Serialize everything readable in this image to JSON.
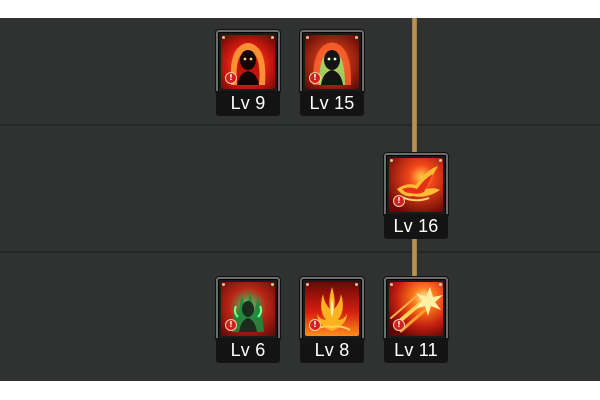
{
  "skill_tree": {
    "skills": [
      {
        "level": "Lv 9"
      },
      {
        "level": "Lv 15"
      },
      {
        "level": "Lv 16"
      },
      {
        "level": "Lv 6"
      },
      {
        "level": "Lv 8"
      },
      {
        "level": "Lv 11"
      }
    ]
  },
  "icons": {
    "skill_1": "fire-demon-icon",
    "skill_2": "flame-spirit-icon",
    "skill_3": "fire-bird-icon",
    "skill_4": "poison-aura-icon",
    "skill_5": "fire-pillar-icon",
    "skill_6": "fire-burst-icon",
    "lock": "lock-badge-icon"
  },
  "colors": {
    "panel_background": "#303131",
    "connector": "#c49a55",
    "icon_red": "#d32a12",
    "icon_orange": "#ff8c1a",
    "poison_green": "#3bd96b",
    "level_text": "#ffffff"
  }
}
